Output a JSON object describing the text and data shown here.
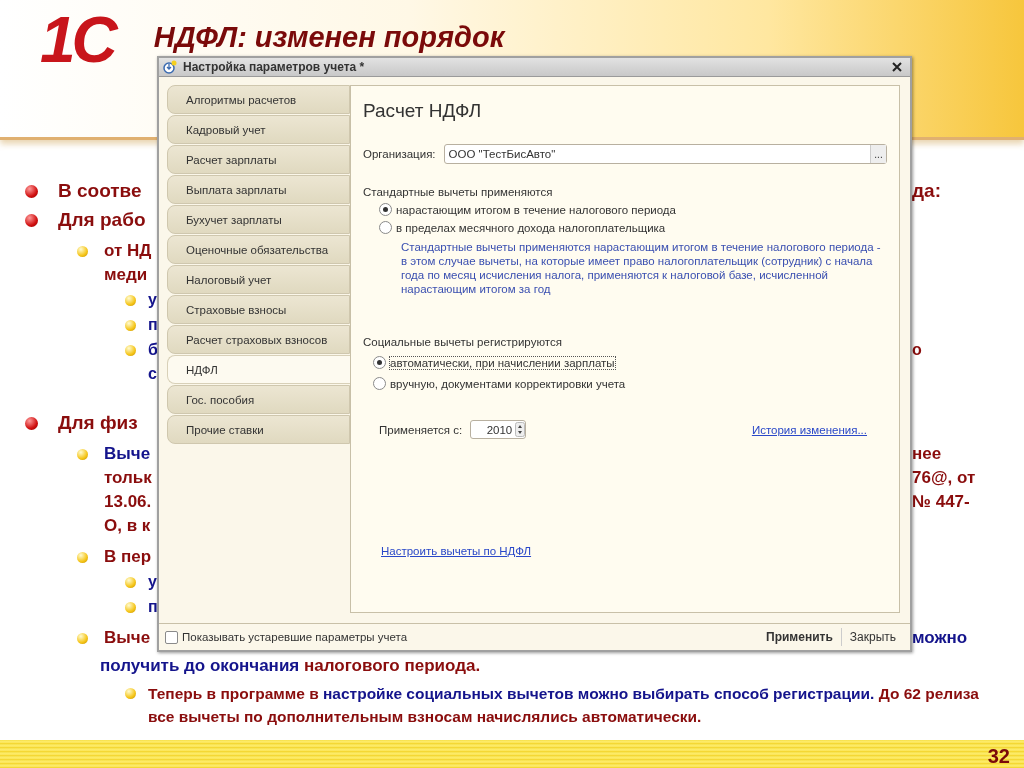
{
  "slide": {
    "logo": "1С",
    "title": "НДФЛ: изменен порядок",
    "page_number": "32",
    "bullets": [
      {
        "lines": [
          {
            "left": {
              "text": "В соотве",
              "color": "#8a0d0d"
            },
            "right": {
              "text": "да:",
              "color": "#8a0d0d"
            }
          }
        ]
      },
      {
        "lines": [
          {
            "left": {
              "text": "Для рабо",
              "color": "#8a0d0d"
            }
          }
        ],
        "children": [
          {
            "lines": [
              {
                "left": {
                  "text": "от НД",
                  "color": "#8a0d0d"
                }
              },
              {
                "left": {
                  "text": "меди",
                  "color": "#8a0d0d"
                }
              }
            ],
            "children": [
              {
                "lines": [
                  {
                    "left": {
                      "text": "у",
                      "color": "#14148c"
                    }
                  }
                ]
              },
              {
                "lines": [
                  {
                    "left": {
                      "text": "п",
                      "color": "#14148c"
                    }
                  }
                ]
              },
              {
                "lines": [
                  {
                    "left": {
                      "text": "б",
                      "color": "#14148c"
                    },
                    "right": {
                      "text": "о",
                      "color": "#8a0d0d"
                    }
                  },
                  {
                    "left": {
                      "text": "с",
                      "color": "#14148c"
                    }
                  }
                ]
              }
            ]
          }
        ]
      },
      {
        "lines": [
          {
            "left": {
              "text": "Для физ",
              "color": "#8a0d0d"
            }
          }
        ],
        "children": [
          {
            "lines": [
              {
                "left": {
                  "text": "Выче",
                  "color": "#14148c"
                },
                "right": {
                  "text": "нее",
                  "color": "#8a0d0d"
                }
              },
              {
                "left": {
                  "text": "тольк",
                  "color": "#8a0d0d"
                },
                "right": {
                  "text": "76@, от",
                  "color": "#8a0d0d"
                }
              },
              {
                "left": {
                  "text": "13.06.",
                  "color": "#8a0d0d"
                },
                "right": {
                  "text": "№ 447-",
                  "color": "#8a0d0d"
                }
              },
              {
                "left": {
                  "text": "О, в к",
                  "color": "#8a0d0d"
                }
              }
            ]
          },
          {
            "lines": [
              {
                "left": {
                  "text": "В пер",
                  "color": "#8a0d0d"
                }
              }
            ],
            "children": [
              {
                "lines": [
                  {
                    "left": {
                      "text": "у",
                      "color": "#14148c"
                    }
                  }
                ]
              },
              {
                "lines": [
                  {
                    "left": {
                      "text": "п",
                      "color": "#14148c"
                    }
                  }
                ]
              }
            ]
          },
          {
            "lines": [
              {
                "left": {
                  "text": "Выче",
                  "color": "#8a0d0d"
                },
                "right": {
                  "text": "можно",
                  "color": "#14148c"
                }
              }
            ],
            "tail": [
              {
                "text": "получить до окончания ",
                "color": "#14148c"
              },
              {
                "text": "налогового периода.",
                "color": "#8a0d0d"
              }
            ],
            "children": [
              {
                "segments": [
                  {
                    "text": "Теперь в программе в ",
                    "color": "#8a0d0d"
                  },
                  {
                    "text": "настройке социальных вычетов можно выбирать способ регистрации.",
                    "color": "#14148c"
                  },
                  {
                    "text": " До 62 релиза все вычеты по дополнительным взносам начислялись автоматически.",
                    "color": "#8a0d0d"
                  }
                ]
              }
            ]
          }
        ]
      }
    ]
  },
  "window": {
    "title": "Настройка параметров учета *",
    "tabs": [
      {
        "label": "Алгоритмы расчетов",
        "selected": false
      },
      {
        "label": "Кадровый учет",
        "selected": false
      },
      {
        "label": "Расчет зарплаты",
        "selected": false
      },
      {
        "label": "Выплата зарплаты",
        "selected": false
      },
      {
        "label": "Бухучет зарплаты",
        "selected": false
      },
      {
        "label": "Оценочные обязательства",
        "selected": false
      },
      {
        "label": "Налоговый учет",
        "selected": false
      },
      {
        "label": "Страховые взносы",
        "selected": false
      },
      {
        "label": "Расчет страховых взносов",
        "selected": false
      },
      {
        "label": "НДФЛ",
        "selected": true
      },
      {
        "label": "Гос. пособия",
        "selected": false
      },
      {
        "label": "Прочие ставки",
        "selected": false
      }
    ],
    "panel": {
      "heading": "Расчет НДФЛ",
      "organization_label": "Организация:",
      "organization_value": "ООО \"ТестБисАвто\"",
      "select_button": "...",
      "standard": {
        "label": "Стандартные вычеты применяются",
        "options": [
          {
            "label": "нарастающим итогом в течение налогового периода",
            "selected": true
          },
          {
            "label": "в пределах месячного дохода налогоплательщика",
            "selected": false
          }
        ],
        "note": "Стандартные вычеты применяются нарастающим итогом в течение налогового периода - в этом случае вычеты, на которые имеет право налогоплательщик (сотрудник) с начала года по месяц исчисления налога, применяются к налоговой базе, исчисленной нарастающим итогом за год"
      },
      "social": {
        "label": "Социальные вычеты регистрируются",
        "options": [
          {
            "label": "автоматически, при начислении зарплаты",
            "selected": true
          },
          {
            "label": "вручную, документами корректировки учета",
            "selected": false
          }
        ]
      },
      "applies_label": "Применяется с:",
      "applies_value": "2010",
      "history_link": "История изменения...",
      "setup_link": "Настроить вычеты по НДФЛ"
    },
    "show_obsolete": {
      "label": "Показывать устаревшие параметры учета",
      "checked": false
    },
    "buttons": [
      {
        "label": "Применить",
        "kind": "default"
      },
      {
        "label": "Закрыть",
        "kind": "plain"
      }
    ]
  }
}
